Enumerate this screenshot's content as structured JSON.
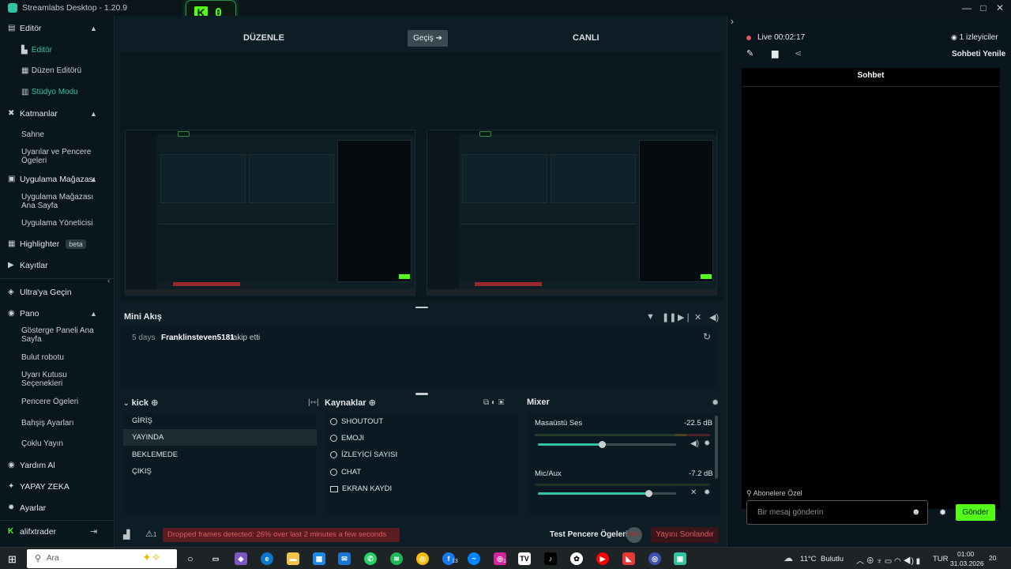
{
  "window": {
    "title": "Streamlabs Desktop - 1.20.9"
  },
  "kick_badge": {
    "icon": "K",
    "count": "0"
  },
  "sidebar": {
    "editor": {
      "label": "Editör",
      "items": [
        "Editör",
        "Düzen Editörü",
        "Stüdyo Modu"
      ]
    },
    "layers": {
      "label": "Katmanlar",
      "items": [
        "Sahne",
        "Uyarılar ve Pencere Ögeleri"
      ]
    },
    "store": {
      "label": "Uygulama Mağazası",
      "items": [
        "Uygulama Mağazası Ana Sayfa",
        "Uygulama Yöneticisi"
      ]
    },
    "highlighter": {
      "label": "Highlighter",
      "badge": "beta"
    },
    "recordings": {
      "label": "Kayıtlar"
    },
    "ultra": {
      "label": "Ultra'ya Geçin"
    },
    "dashboard": {
      "label": "Pano",
      "items": [
        "Gösterge Paneli Ana Sayfa",
        "Bulut robotu",
        "Uyarı Kutusu Seçenekleri",
        "Pencere Ögeleri",
        "Bahşiş Ayarları",
        "Çoklu Yayın"
      ]
    },
    "help": {
      "label": "Yardım Al"
    },
    "ai": {
      "label": "YAPAY ZEKA"
    },
    "settings": {
      "label": "Ayarlar"
    },
    "user": {
      "label": "alifxtrader"
    }
  },
  "editor": {
    "edit_label": "DÜZENLE",
    "live_label": "CANLI",
    "switch_label": "Geçiş ➔"
  },
  "mini_feed": {
    "title": "Mini Akış",
    "entry": {
      "time": "5 days",
      "name": "Franklinsteven5181",
      "action": "takip etti"
    }
  },
  "scenes": {
    "title": "kick",
    "items": [
      "GİRİŞ",
      "YAYINDA",
      "BEKLEMEDE",
      "ÇIKIŞ"
    ],
    "selected": "YAYINDA"
  },
  "sources": {
    "title": "Kaynaklar",
    "items": [
      "SHOUTOUT",
      "EMOJI",
      "İZLEYİCİ SAYISI",
      "CHAT",
      "EKRAN KAYDI"
    ]
  },
  "mixer": {
    "title": "Mixer",
    "channels": [
      {
        "name": "Masaüstü Ses",
        "db": "-22.5 dB",
        "level": 0.46
      },
      {
        "name": "Mic/Aux",
        "db": "-7.2 dB",
        "level": 0.8
      }
    ]
  },
  "footer": {
    "warning": "Dropped frames detected: 26% over last 2 minutes a few seconds ago",
    "alert_count": "1",
    "test_label": "Test Pencere Ögeleri",
    "rec_label": "REC",
    "end_label": "Yayını Sonlandır"
  },
  "right_panel": {
    "live_label": "Live",
    "live_time": "00:02:17",
    "viewers": "1 izleyiciler",
    "refresh_chat": "Sohbeti Yenile",
    "chat_title": "Sohbet",
    "subscribers_only": "Abonelere Özel",
    "chat_placeholder": "Bir mesaj gönderin",
    "send_label": "Gönder"
  },
  "taskbar": {
    "search_placeholder": "Ara",
    "weather": "11°C",
    "weather_text": "Bulutlu",
    "lang": "TUR",
    "time": "01:00",
    "date": "31.03.2026",
    "notif_count": "20",
    "badge_13": "13",
    "badge_1": "1"
  },
  "colors": {
    "accent": "#31c3a2",
    "kick_green": "#53fc18",
    "danger": "#e25a62"
  }
}
